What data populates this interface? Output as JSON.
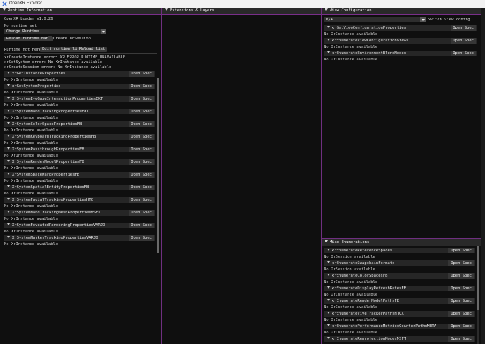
{
  "window": {
    "title": "OpenXR Explorer"
  },
  "runtime": {
    "header": "Runtime Information",
    "loader": "OpenXR Loader v1.0.26",
    "no_runtime": "No runtime set",
    "combo_value": "Change Runtime",
    "reload_btn": "Reload runtime data",
    "create_session": "Create XrSession",
    "not_here": "Runtime not Here?",
    "edit_list_btn": "Edit runtime list",
    "reload_list_btn": "Reload list",
    "errors": [
      "xrCreateInstance error: XR_ERROR_RUNTIME_UNAVAILABLE",
      "xrGetSystem error: No XrInstance available",
      "xrCreateSession error: No XrInstance available"
    ],
    "open_spec": "Open Spec",
    "sections": [
      {
        "name": "xrGetInstanceProperties",
        "note": "No XrInstance available"
      },
      {
        "name": "xrGetSystemProperties",
        "note": "No XrInstance available"
      },
      {
        "name": "XrSystemEyeGazeInteractionPropertiesEXT",
        "note": "No XrInstance available"
      },
      {
        "name": "XrSystemHandTrackingPropertiesEXT",
        "note": "No XrInstance available"
      },
      {
        "name": "XrSystemColorSpacePropertiesFB",
        "note": "No XrInstance available"
      },
      {
        "name": "XrSystemKeyboardTrackingPropertiesFB",
        "note": "No XrInstance available"
      },
      {
        "name": "XrSystemPassthroughPropertiesFB",
        "note": "No XrInstance available"
      },
      {
        "name": "XrSystemRenderModelPropertiesFB",
        "note": "No XrInstance available"
      },
      {
        "name": "XrSystemSpaceWarpPropertiesFB",
        "note": "No XrInstance available"
      },
      {
        "name": "XrSystemSpatialEntityPropertiesFB",
        "note": "No XrInstance available"
      },
      {
        "name": "XrSystemFacialTrackingPropertiesHTC",
        "note": "No XrInstance available"
      },
      {
        "name": "XrSystemHandTrackingMeshPropertiesMSFT",
        "note": "No XrInstance available"
      },
      {
        "name": "XrSystemFoveatedRenderingPropertiesVARJO",
        "note": "No XrInstance available"
      },
      {
        "name": "XrSystemMarkerTrackingPropertiesVARJO",
        "note": "No XrInstance available"
      }
    ]
  },
  "extensions": {
    "header": "Extensions & Layers"
  },
  "view": {
    "header": "View Configuration",
    "combo_value": "N/A",
    "switch_label": "Switch view config",
    "open_spec": "Open Spec",
    "sections": [
      {
        "name": "xrGetViewConfigurationProperties",
        "note": "No XrInstance available"
      },
      {
        "name": "xrEnumerateViewConfigurationViews",
        "note": "No XrInstance available"
      },
      {
        "name": "xrEnumerateEnvironmentBlendModes",
        "note": "No XrInstance available"
      }
    ]
  },
  "misc": {
    "header": "Misc Enumerations",
    "open_spec": "Open Spec",
    "sections": [
      {
        "name": "xrEnumerateReferenceSpaces",
        "note": "No XrSession available"
      },
      {
        "name": "xrEnumerateSwapchainFormats",
        "note": "No XrSession available"
      },
      {
        "name": "xrEnumerateColorSpacesFB",
        "note": "No XrInstance available"
      },
      {
        "name": "xrEnumerateDisplayRefreshRatesFB",
        "note": "No XrInstance available"
      },
      {
        "name": "xrEnumerateRenderModelPathsFB",
        "note": "No XrInstance available"
      },
      {
        "name": "xrEnumerateViveTrackerPathsHTCX",
        "note": "No XrInstance available"
      },
      {
        "name": "xrEnumeratePerformanceMetricsCounterPathsMETA",
        "note": "No XrInstance available"
      },
      {
        "name": "xrEnumerateReprojectionModesMSFT",
        "note": ""
      }
    ]
  }
}
